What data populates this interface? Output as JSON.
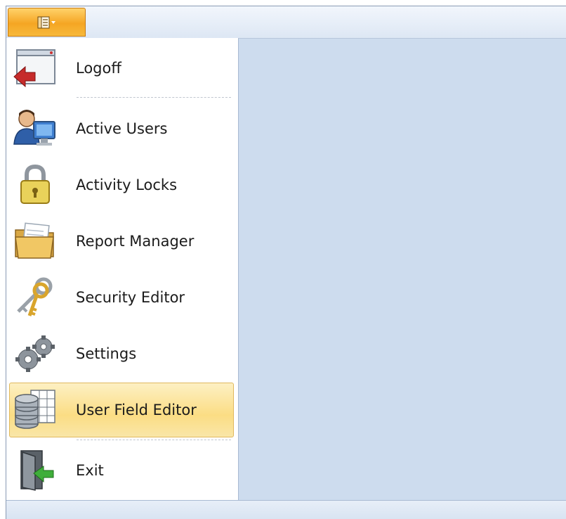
{
  "app_button": {
    "icon": "app-menu-icon",
    "dropdown_icon": "chevron-down-icon"
  },
  "menu": {
    "items": [
      {
        "label": "Logoff",
        "icon": "logoff-icon"
      },
      {
        "label": "Active Users",
        "icon": "active-users-icon"
      },
      {
        "label": "Activity Locks",
        "icon": "lock-icon"
      },
      {
        "label": "Report Manager",
        "icon": "folder-icon"
      },
      {
        "label": "Security Editor",
        "icon": "keys-icon"
      },
      {
        "label": "Settings",
        "icon": "gears-icon"
      },
      {
        "label": "User Field Editor",
        "icon": "database-grid-icon",
        "selected": true
      },
      {
        "label": "Exit",
        "icon": "exit-door-icon"
      }
    ]
  },
  "colors": {
    "accent": "#f5a623",
    "selection": "#fbdd84",
    "pane": "#cddcee"
  }
}
